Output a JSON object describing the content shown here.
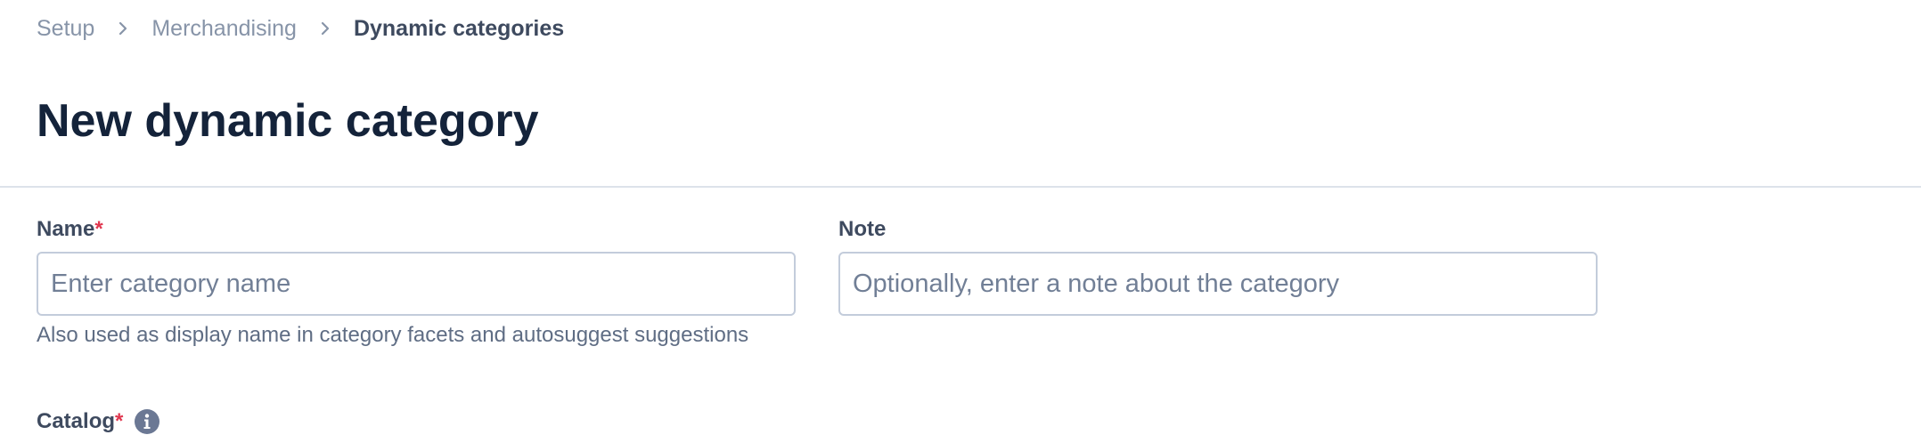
{
  "breadcrumb": {
    "items": [
      {
        "label": "Setup"
      },
      {
        "label": "Merchandising"
      }
    ],
    "current": "Dynamic categories"
  },
  "page": {
    "title": "New dynamic category"
  },
  "form": {
    "name": {
      "label": "Name",
      "required_marker": "*",
      "placeholder": "Enter category name",
      "value": "",
      "help": "Also used as display name in category facets and autosuggest suggestions"
    },
    "note": {
      "label": "Note",
      "placeholder": "Optionally, enter a note about the category",
      "value": ""
    },
    "catalog": {
      "label": "Catalog",
      "required_marker": "*",
      "info_icon": "info-icon"
    }
  },
  "icons": {
    "breadcrumb_separator": "chevron-right-icon"
  },
  "colors": {
    "title": "#14233a",
    "label": "#3e4a5f",
    "muted": "#8794a8",
    "required": "#e0374f",
    "border": "#c3ccdb",
    "info_icon": "#6b7894"
  }
}
